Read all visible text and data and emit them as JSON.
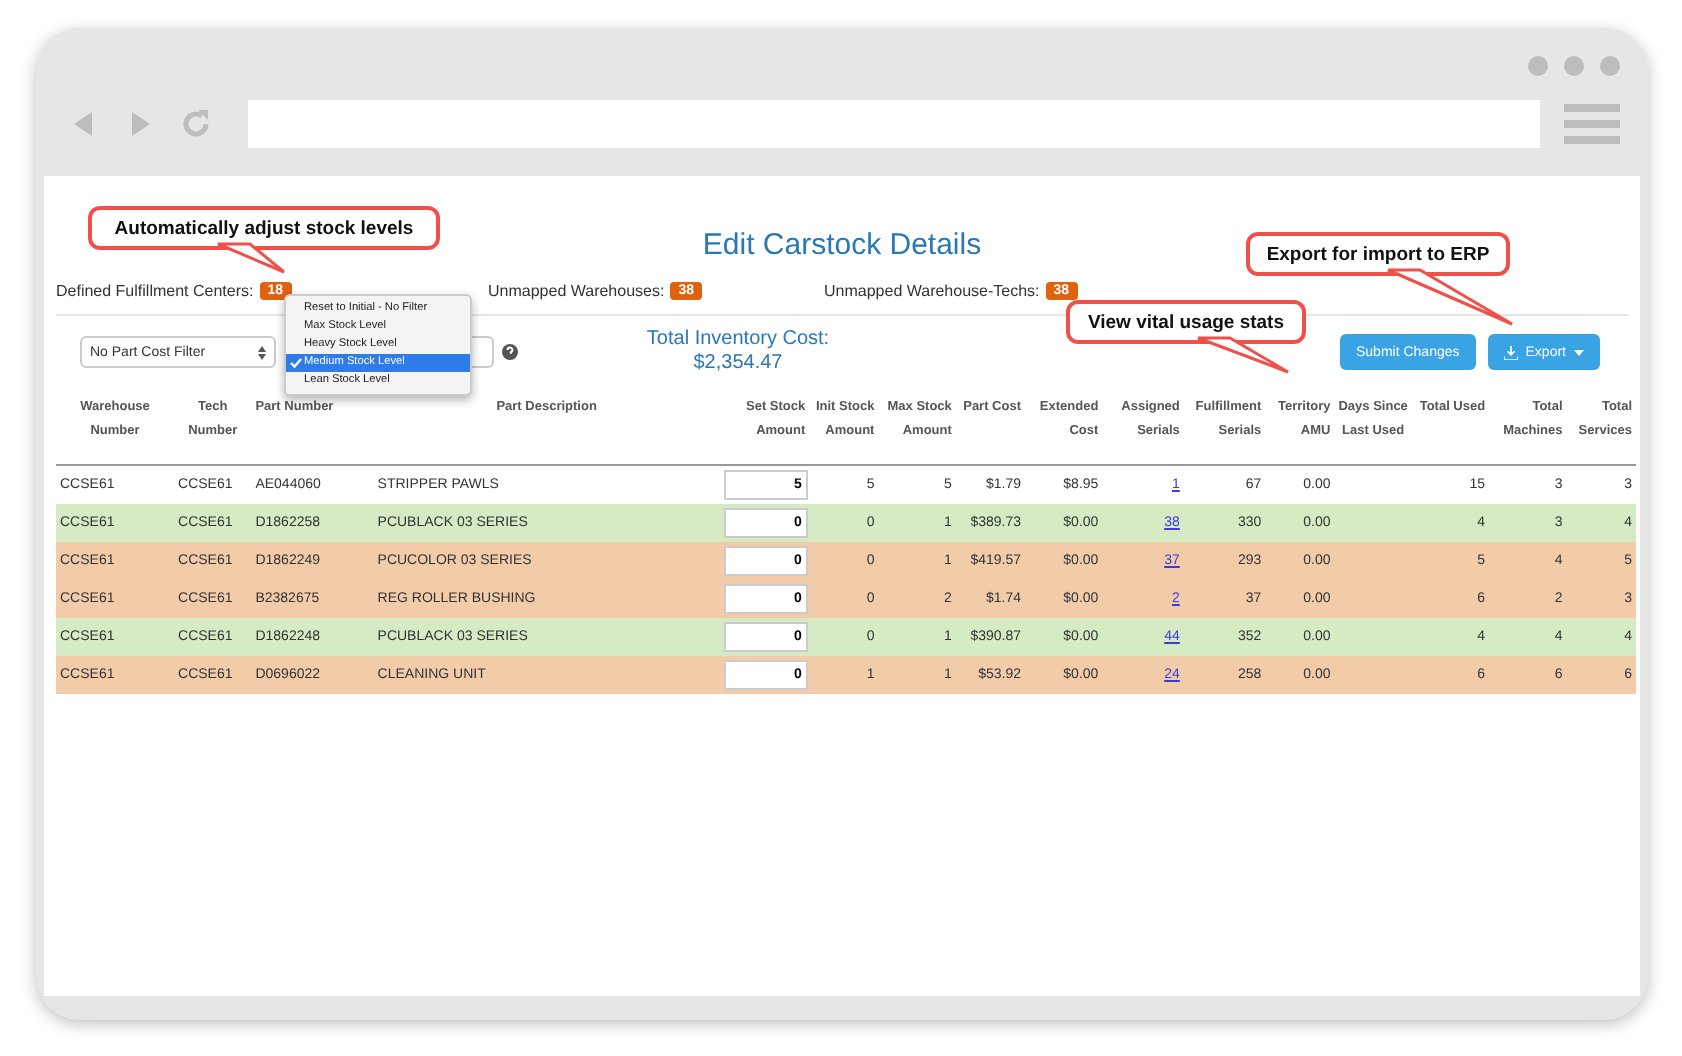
{
  "page": {
    "title": "Edit Carstock Details"
  },
  "summary": [
    {
      "label": "Defined Fulfillment Centers:",
      "count": "18"
    },
    {
      "label": "Unmapped Warehouses:",
      "count": "38"
    },
    {
      "label": "Unmapped Warehouse-Techs:",
      "count": "38"
    }
  ],
  "cost_filter": {
    "value": "No Part Cost Filter"
  },
  "stock_level_menu": {
    "expanded": true,
    "options": [
      {
        "label": "Reset to Initial - No Filter",
        "selected": false
      },
      {
        "label": "Max Stock Level",
        "selected": false
      },
      {
        "label": "Heavy Stock Level",
        "selected": false
      },
      {
        "label": "Medium Stock Level",
        "selected": true
      },
      {
        "label": "Lean Stock Level",
        "selected": false
      }
    ]
  },
  "total_inventory": {
    "label": "Total Inventory Cost:",
    "value": "$2,354.47"
  },
  "buttons": [
    {
      "label": "Submit Changes",
      "kind": "submit"
    },
    {
      "label": "Export",
      "kind": "export"
    }
  ],
  "table": {
    "columns": [
      "Warehouse Number",
      "Tech Number",
      "Part Number",
      "Part Description",
      "Set Stock Amount",
      "Init Stock Amount",
      "Max Stock Amount",
      "Part Cost",
      "Extended Cost",
      "Assigned Serials",
      "Fulfillment Serials",
      "Territory AMU",
      "Days Since Last Used",
      "Total Used",
      "Total Machines",
      "Total Services"
    ],
    "rows": [
      {
        "color": "#ffffff",
        "cells": [
          "CCSE61",
          "CCSE61",
          "AE044060",
          "STRIPPER PAWLS",
          "5",
          "5",
          "5",
          "$1.79",
          "$8.95",
          "1",
          "67",
          "0.00",
          "",
          "15",
          "3",
          "3"
        ]
      },
      {
        "color": "#d6ebc4",
        "cells": [
          "CCSE61",
          "CCSE61",
          "D1862258",
          "PCUBLACK 03 SERIES",
          "0",
          "0",
          "1",
          "$389.73",
          "$0.00",
          "38",
          "330",
          "0.00",
          "",
          "4",
          "3",
          "4"
        ]
      },
      {
        "color": "#f2cba8",
        "cells": [
          "CCSE61",
          "CCSE61",
          "D1862249",
          "PCUCOLOR 03 SERIES",
          "0",
          "0",
          "1",
          "$419.57",
          "$0.00",
          "37",
          "293",
          "0.00",
          "",
          "5",
          "4",
          "5"
        ]
      },
      {
        "color": "#f2cba8",
        "cells": [
          "CCSE61",
          "CCSE61",
          "B2382675",
          "REG ROLLER BUSHING",
          "0",
          "0",
          "2",
          "$1.74",
          "$0.00",
          "2",
          "37",
          "0.00",
          "",
          "6",
          "2",
          "3"
        ]
      },
      {
        "color": "#d6ebc4",
        "cells": [
          "CCSE61",
          "CCSE61",
          "D1862248",
          "PCUBLACK 03 SERIES",
          "0",
          "0",
          "1",
          "$390.87",
          "$0.00",
          "44",
          "352",
          "0.00",
          "",
          "4",
          "4",
          "4"
        ]
      },
      {
        "color": "#f2cba8",
        "cells": [
          "CCSE61",
          "CCSE61",
          "D0696022",
          "CLEANING UNIT",
          "0",
          "1",
          "1",
          "$53.92",
          "$0.00",
          "24",
          "258",
          "0.00",
          "",
          "6",
          "6",
          "6"
        ]
      }
    ]
  },
  "callouts": [
    {
      "text": "Automatically adjust stock levels"
    },
    {
      "text": "Export for import to ERP"
    },
    {
      "text": "View vital usage stats"
    }
  ]
}
